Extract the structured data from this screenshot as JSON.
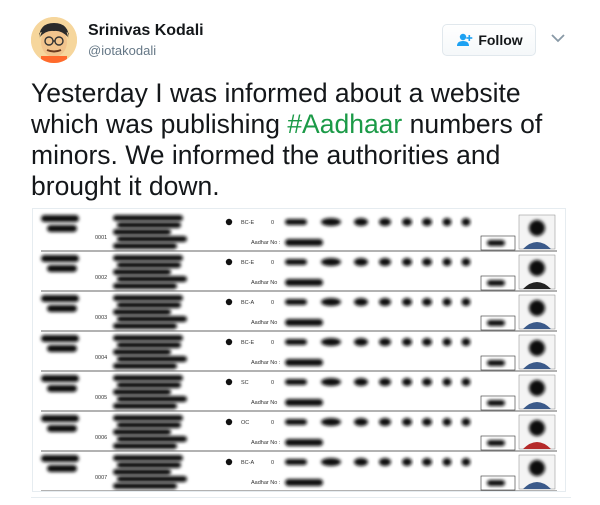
{
  "user": {
    "name": "Srinivas Kodali",
    "handle": "@iotakodali"
  },
  "actions": {
    "follow_label": "Follow"
  },
  "tweet": {
    "text_before": "Yesterday I was informed about a website which was publishing ",
    "hashtag": "#Aadhaar",
    "text_after": " numbers of minors. We informed the authorities and brought it down."
  },
  "icons": {
    "follow": "add-user-icon",
    "more": "chevron-down-icon"
  },
  "colors": {
    "hashtag": "#1b9a47",
    "muted": "#657786"
  },
  "document": {
    "rows": [
      {
        "id": "0001",
        "category": "BC-E",
        "zero": "0",
        "aadhar_label": "Aadhar No :"
      },
      {
        "id": "0002",
        "category": "BC-E",
        "zero": "0",
        "aadhar_label": "Aadhar No"
      },
      {
        "id": "0003",
        "category": "BC-A",
        "zero": "0",
        "aadhar_label": "Aadhar No"
      },
      {
        "id": "0004",
        "category": "BC-E",
        "zero": "0",
        "aadhar_label": "Aadhar No :"
      },
      {
        "id": "0005",
        "category": "SC",
        "zero": "0",
        "aadhar_label": "Aadhar No"
      },
      {
        "id": "0006",
        "category": "OC",
        "zero": "0",
        "aadhar_label": "Aadhar No :"
      },
      {
        "id": "0007",
        "category": "BC-A",
        "zero": "0",
        "aadhar_label": "Aadhar No :"
      }
    ]
  }
}
